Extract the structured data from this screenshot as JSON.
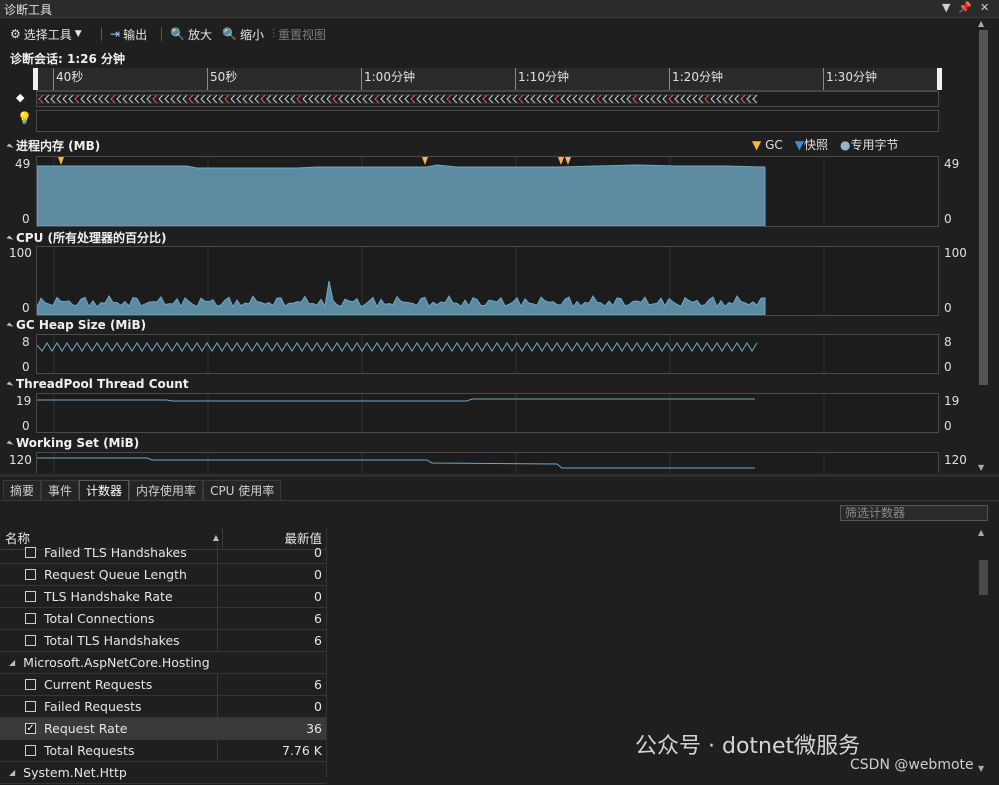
{
  "window": {
    "title": "诊断工具"
  },
  "toolbar": {
    "select_tool": "选择工具",
    "output": "输出",
    "zoom_in": "放大",
    "zoom_out": "缩小",
    "reset_view": "重置视图"
  },
  "session": {
    "label": "诊断会话: 1:26 分钟"
  },
  "ruler": {
    "labels": [
      "40秒",
      "50秒",
      "1:00分钟",
      "1:10分钟",
      "1:20分钟",
      "1:30分钟"
    ]
  },
  "sections": {
    "memory": {
      "title": "进程内存 (MB)",
      "max": "49",
      "min": "0"
    },
    "cpu": {
      "title": "CPU (所有处理器的百分比)",
      "max": "100",
      "min": "0"
    },
    "gcheap": {
      "title": "GC Heap Size (MiB)",
      "max": "8",
      "min": "0"
    },
    "threadpool": {
      "title": "ThreadPool Thread Count",
      "max": "19",
      "min": "0"
    },
    "workingset": {
      "title": "Working Set (MiB)",
      "max": "120"
    }
  },
  "legend": {
    "gc": "GC",
    "snapshot": "快照",
    "private_bytes": "专用字节"
  },
  "tabs": [
    "摘要",
    "事件",
    "计数器",
    "内存使用率",
    "CPU 使用率"
  ],
  "filter": {
    "placeholder": "筛选计数器"
  },
  "grid": {
    "col_name": "名称",
    "col_value": "最新值",
    "rows": [
      {
        "name": "Failed TLS Handshakes",
        "value": "0"
      },
      {
        "name": "Request Queue Length",
        "value": "0"
      },
      {
        "name": "TLS Handshake Rate",
        "value": "0"
      },
      {
        "name": "Total Connections",
        "value": "6"
      },
      {
        "name": "Total TLS Handshakes",
        "value": "6"
      },
      {
        "group": "Microsoft.AspNetCore.Hosting"
      },
      {
        "name": "Current Requests",
        "value": "6"
      },
      {
        "name": "Failed Requests",
        "value": "0"
      },
      {
        "name": "Request Rate",
        "value": "36",
        "checked": true
      },
      {
        "name": "Total Requests",
        "value": "7.76 K"
      },
      {
        "group": "System.Net.Http"
      }
    ]
  },
  "watermark": {
    "text": "公众号 · dotnet微服务",
    "csdn": "CSDN @webmote"
  },
  "colors": {
    "chart_fill": "#5b8aa1",
    "chart_line": "#6fa8c6",
    "gc_marker": "#f2b84b",
    "snapshot": "#3f8fd8"
  }
}
